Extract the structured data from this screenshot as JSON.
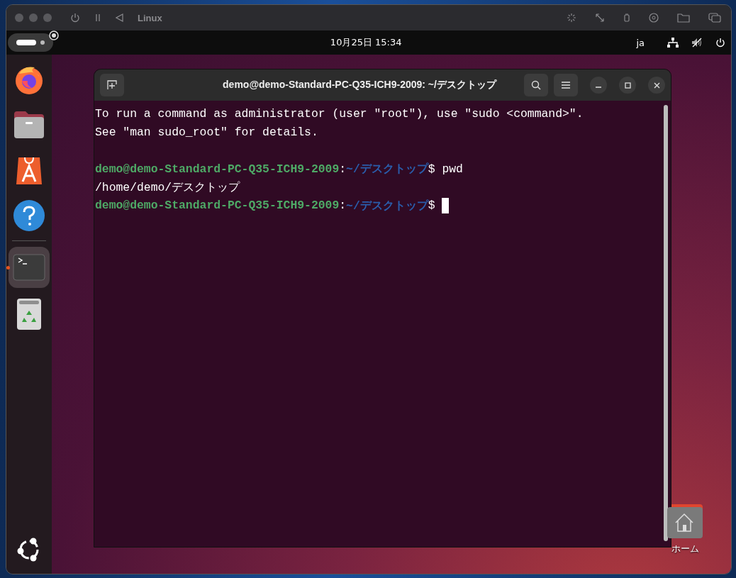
{
  "vm_window": {
    "title": "Linux"
  },
  "top_bar": {
    "datetime": "10月25日  15:34",
    "input_method": "ja"
  },
  "dock": {
    "items": [
      {
        "kind": "firefox",
        "running": false
      },
      {
        "kind": "files",
        "running": false
      },
      {
        "kind": "software",
        "running": false
      },
      {
        "kind": "help",
        "running": false
      },
      {
        "kind": "terminal",
        "running": true
      },
      {
        "kind": "trash",
        "running": false
      }
    ]
  },
  "terminal": {
    "title": "demo@demo-Standard-PC-Q35-ICH9-2009: ~/デスクトップ",
    "lines": [
      {
        "kind": "output",
        "text": "To run a command as administrator (user \"root\"), use \"sudo <command>\"."
      },
      {
        "kind": "output",
        "text": "See \"man sudo_root\" for details."
      },
      {
        "kind": "blank"
      },
      {
        "kind": "prompt",
        "user_host": "demo@demo-Standard-PC-Q35-ICH9-2009",
        "sep": ":",
        "path": "~/デスクトップ",
        "symbol": "$",
        "command": "pwd",
        "cursor": false
      },
      {
        "kind": "output",
        "text": "/home/demo/デスクトップ"
      },
      {
        "kind": "prompt",
        "user_host": "demo@demo-Standard-PC-Q35-ICH9-2009",
        "sep": ":",
        "path": "~/デスクトップ",
        "symbol": "$",
        "cursor": true
      }
    ]
  },
  "desktop_icons": [
    {
      "label": "ホーム"
    }
  ]
}
